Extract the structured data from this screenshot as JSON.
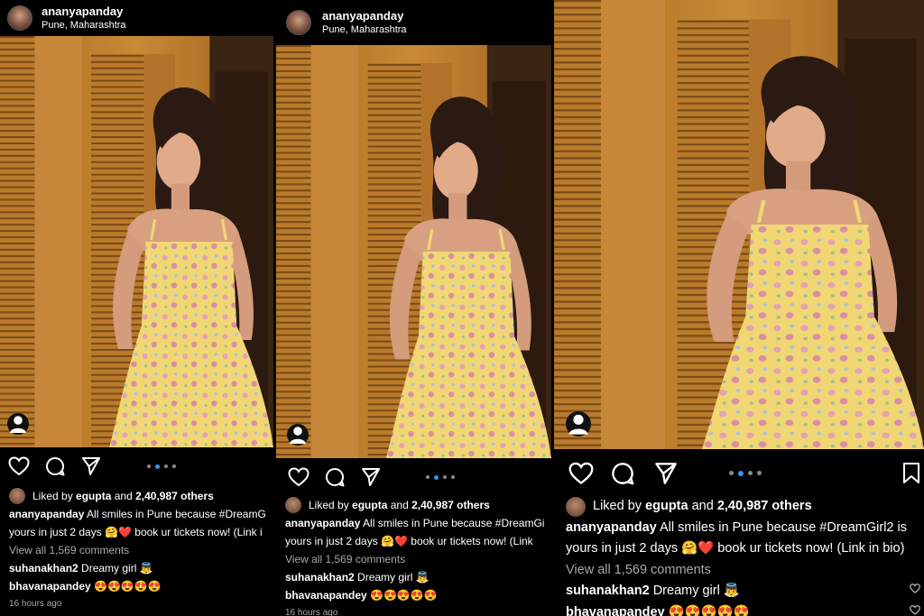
{
  "post": {
    "username": "ananyapanday",
    "location": "Pune, Maharashtra",
    "liked_by_prefix": "Liked by",
    "liked_by_user": "egupta",
    "liked_by_and": "and",
    "liked_count": "2,40,987 others",
    "caption_user": "ananyapanday",
    "caption_text": "All smiles in Pune because #DreamGirl2 is yours in just 2 days 🤗❤️ book ur tickets now! (Link in bio)",
    "caption_line1_short": "All smiles in Pune because #DreamGi",
    "caption_line2_short1": "yours in just 2 days 🤗❤️ book ur tickets now! (Link i",
    "caption_line2_short2": "yours in just 2 days 🤗❤️ book ur tickets now! (Link",
    "caption_line1_full": "All smiles in Pune because #DreamGirl2 is",
    "caption_line2_full": "yours in just 2 days 🤗❤️ book ur tickets now! (Link in bio)",
    "view_comments": "View all 1,569 comments",
    "comments": [
      {
        "user": "suhanakhan2",
        "text": "Dreamy girl 👼"
      },
      {
        "user": "bhavanapandey",
        "text": "😍😍😍😍😍"
      }
    ],
    "time": "16 hours ago"
  },
  "icons": [
    "avatar",
    "tag-user-icon",
    "heart-icon",
    "comment-icon",
    "share-icon",
    "carousel-dots",
    "bookmark-icon"
  ],
  "colors": {
    "background": "#000000",
    "text": "#ffffff",
    "muted": "#a8a8a8",
    "carousel_active": "#3897f0"
  }
}
